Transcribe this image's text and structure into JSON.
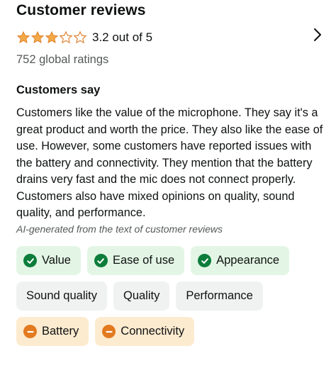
{
  "header": {
    "title": "Customer reviews",
    "rating": 3.2,
    "rating_text": "3.2 out of 5",
    "ratings_count": "752 global ratings",
    "star_color": "#f3a847"
  },
  "customers_say": {
    "title": "Customers say",
    "summary": "Customers like the value of the microphone. They say it's a great product and worth the price. They also like the ease of use. However, some customers have reported issues with the battery and connectivity. They mention that the battery drains very fast and the mic does not connect properly. Customers also have mixed opinions on quality, sound quality, and performance.",
    "ai_note": "AI-generated from the text of customer reviews"
  },
  "aspects": {
    "positive": [
      "Value",
      "Ease of use",
      "Appearance"
    ],
    "mixed": [
      "Sound quality",
      "Quality",
      "Performance"
    ],
    "negative": [
      "Battery",
      "Connectivity"
    ]
  },
  "colors": {
    "positive_bg": "#e3f6e5",
    "positive_icon": "#0c7d3b",
    "mixed_bg": "#f0f2f2",
    "negative_bg": "#fdebd0",
    "negative_icon": "#e37a1f"
  }
}
